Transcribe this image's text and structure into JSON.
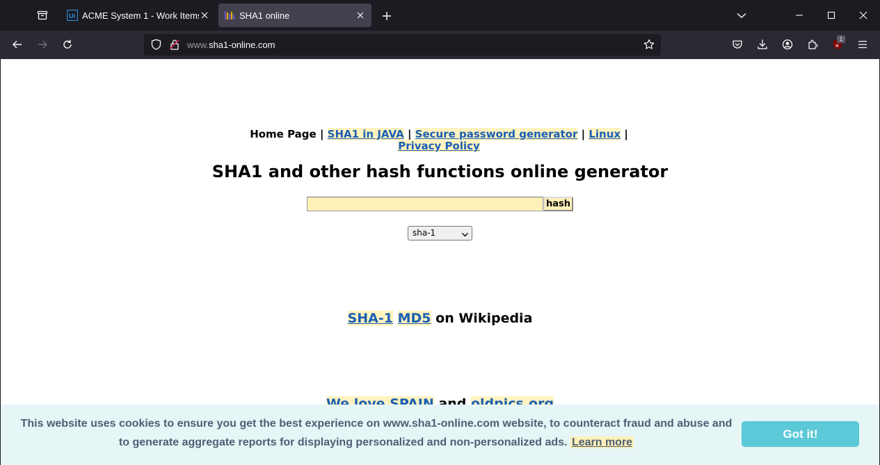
{
  "browser": {
    "tabs": [
      {
        "title": "ACME System 1 - Work Items",
        "favicon": "uipath-icon",
        "active": false
      },
      {
        "title": "SHA1 online",
        "favicon": "sha1-online-icon",
        "active": true
      }
    ],
    "url_prefix": "www.",
    "url_domain": "sha1-online.com",
    "extension_badge": "1"
  },
  "page": {
    "nav": {
      "home": "Home Page",
      "sep": "|",
      "links": [
        "SHA1 in JAVA",
        "Secure password generator",
        "Linux",
        "Privacy Policy"
      ]
    },
    "title": "SHA1 and other hash functions online generator",
    "input_value": "",
    "hash_button": "hash",
    "algorithm": "sha-1",
    "wiki": {
      "link1": "SHA-1",
      "link2": "MD5",
      "suffix": "on Wikipedia"
    },
    "love": {
      "prefix": "We love",
      "link1": "SPAIN",
      "and": "and",
      "link2": "oldpics.org"
    }
  },
  "cookie": {
    "message": "This website uses cookies to ensure you get the best experience on www.sha1-online.com website, to counteract fraud and abuse and to generate aggregate reports for displaying personalized and non-personalized ads.",
    "learn_more": "Learn more",
    "button": "Got it!"
  },
  "colors": {
    "link": "#1a5fb4",
    "link_highlight": "#fff3c0",
    "cookie_bg": "#e6f5f6",
    "cookie_button": "#5bc9d7"
  }
}
